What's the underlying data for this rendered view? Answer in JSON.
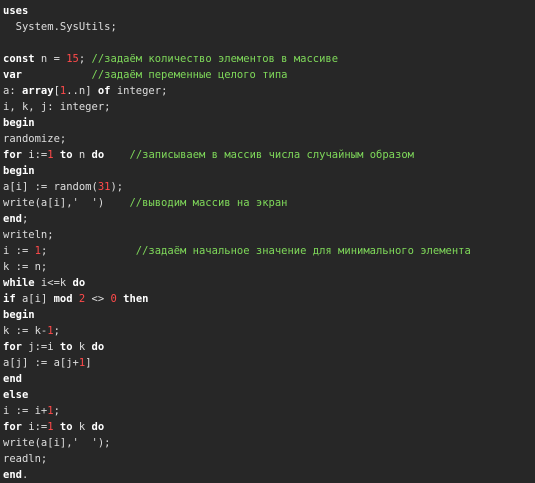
{
  "colors": {
    "background": "#272727",
    "text": "#dedede",
    "keyword": "#ffffff",
    "number": "#ff4a4a",
    "comment": "#7fd95a"
  },
  "editor": {
    "lines": [
      {
        "tokens": [
          {
            "t": "kw",
            "v": "uses"
          }
        ]
      },
      {
        "tokens": [
          {
            "t": "op",
            "v": "  System.SysUtils;"
          }
        ]
      },
      {
        "tokens": []
      },
      {
        "tokens": [
          {
            "t": "kw",
            "v": "const"
          },
          {
            "t": "op",
            "v": " n = "
          },
          {
            "t": "num",
            "v": "15"
          },
          {
            "t": "op",
            "v": "; "
          },
          {
            "t": "cm",
            "v": "//задаём количество элементов в массиве"
          }
        ]
      },
      {
        "tokens": [
          {
            "t": "kw",
            "v": "var"
          },
          {
            "t": "op",
            "v": "           "
          },
          {
            "t": "cm",
            "v": "//задаём переменные целого типа"
          }
        ]
      },
      {
        "tokens": [
          {
            "t": "op",
            "v": "a: "
          },
          {
            "t": "kw",
            "v": "array"
          },
          {
            "t": "op",
            "v": "["
          },
          {
            "t": "num",
            "v": "1"
          },
          {
            "t": "op",
            "v": "..n] "
          },
          {
            "t": "kw",
            "v": "of"
          },
          {
            "t": "op",
            "v": " integer;"
          }
        ]
      },
      {
        "tokens": [
          {
            "t": "op",
            "v": "i, k, j: integer;"
          }
        ]
      },
      {
        "tokens": [
          {
            "t": "kw",
            "v": "begin"
          }
        ]
      },
      {
        "tokens": [
          {
            "t": "op",
            "v": "randomize;"
          }
        ]
      },
      {
        "tokens": [
          {
            "t": "kw",
            "v": "for"
          },
          {
            "t": "op",
            "v": " i:="
          },
          {
            "t": "num",
            "v": "1"
          },
          {
            "t": "op",
            "v": " "
          },
          {
            "t": "kw",
            "v": "to"
          },
          {
            "t": "op",
            "v": " n "
          },
          {
            "t": "kw",
            "v": "do"
          },
          {
            "t": "op",
            "v": "    "
          },
          {
            "t": "cm",
            "v": "//записываем в массив числа случайным образом"
          }
        ]
      },
      {
        "tokens": [
          {
            "t": "kw",
            "v": "begin"
          }
        ]
      },
      {
        "tokens": [
          {
            "t": "op",
            "v": "a[i] := random("
          },
          {
            "t": "num",
            "v": "31"
          },
          {
            "t": "op",
            "v": ");"
          }
        ]
      },
      {
        "tokens": [
          {
            "t": "op",
            "v": "write(a[i],"
          },
          {
            "t": "str",
            "v": "'  '"
          },
          {
            "t": "op",
            "v": ")    "
          },
          {
            "t": "cm",
            "v": "//выводим массив на экран"
          }
        ]
      },
      {
        "tokens": [
          {
            "t": "kw",
            "v": "end"
          },
          {
            "t": "op",
            "v": ";"
          }
        ]
      },
      {
        "tokens": [
          {
            "t": "op",
            "v": "writeln;"
          }
        ]
      },
      {
        "tokens": [
          {
            "t": "op",
            "v": "i := "
          },
          {
            "t": "num",
            "v": "1"
          },
          {
            "t": "op",
            "v": ";              "
          },
          {
            "t": "cm",
            "v": "//задаём начальное значение для минимального элемента"
          }
        ]
      },
      {
        "tokens": [
          {
            "t": "op",
            "v": "k := n;"
          }
        ]
      },
      {
        "tokens": [
          {
            "t": "kw",
            "v": "while"
          },
          {
            "t": "op",
            "v": " i<=k "
          },
          {
            "t": "kw",
            "v": "do"
          }
        ]
      },
      {
        "tokens": [
          {
            "t": "kw",
            "v": "if"
          },
          {
            "t": "op",
            "v": " a[i] "
          },
          {
            "t": "kw",
            "v": "mod"
          },
          {
            "t": "op",
            "v": " "
          },
          {
            "t": "num",
            "v": "2"
          },
          {
            "t": "op",
            "v": " <> "
          },
          {
            "t": "num",
            "v": "0"
          },
          {
            "t": "op",
            "v": " "
          },
          {
            "t": "kw",
            "v": "then"
          }
        ]
      },
      {
        "tokens": [
          {
            "t": "kw",
            "v": "begin"
          }
        ]
      },
      {
        "tokens": [
          {
            "t": "op",
            "v": "k := k-"
          },
          {
            "t": "num",
            "v": "1"
          },
          {
            "t": "op",
            "v": ";"
          }
        ]
      },
      {
        "tokens": [
          {
            "t": "kw",
            "v": "for"
          },
          {
            "t": "op",
            "v": " j:=i "
          },
          {
            "t": "kw",
            "v": "to"
          },
          {
            "t": "op",
            "v": " k "
          },
          {
            "t": "kw",
            "v": "do"
          }
        ]
      },
      {
        "tokens": [
          {
            "t": "op",
            "v": "a[j] := a[j+"
          },
          {
            "t": "num",
            "v": "1"
          },
          {
            "t": "op",
            "v": "]"
          }
        ]
      },
      {
        "tokens": [
          {
            "t": "kw",
            "v": "end"
          }
        ]
      },
      {
        "tokens": [
          {
            "t": "kw",
            "v": "else"
          }
        ]
      },
      {
        "tokens": [
          {
            "t": "op",
            "v": "i := i+"
          },
          {
            "t": "num",
            "v": "1"
          },
          {
            "t": "op",
            "v": ";"
          }
        ]
      },
      {
        "tokens": [
          {
            "t": "kw",
            "v": "for"
          },
          {
            "t": "op",
            "v": " i:="
          },
          {
            "t": "num",
            "v": "1"
          },
          {
            "t": "op",
            "v": " "
          },
          {
            "t": "kw",
            "v": "to"
          },
          {
            "t": "op",
            "v": " k "
          },
          {
            "t": "kw",
            "v": "do"
          }
        ]
      },
      {
        "tokens": [
          {
            "t": "op",
            "v": "write(a[i],"
          },
          {
            "t": "str",
            "v": "'  '"
          },
          {
            "t": "op",
            "v": ");"
          }
        ]
      },
      {
        "tokens": [
          {
            "t": "op",
            "v": "readln;"
          }
        ]
      },
      {
        "tokens": [
          {
            "t": "kw",
            "v": "end"
          },
          {
            "t": "op",
            "v": "."
          }
        ]
      }
    ]
  }
}
